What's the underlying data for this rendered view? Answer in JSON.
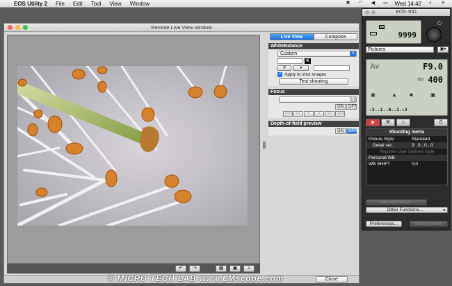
{
  "menubar": {
    "app": "EOS Utility 2",
    "items": [
      "File",
      "Edit",
      "Tool",
      "View",
      "Window"
    ],
    "time": "Wed 14:42"
  },
  "liveview": {
    "title": "Remote Live View window",
    "tabs": [
      "Live View",
      "Compose"
    ],
    "wb_header": "WhiteBalance",
    "wb_value": "Custom",
    "k_label": "K",
    "apply_label": "Apply to shot images",
    "test_shooting": "Test shooting",
    "focus_header": "Focus",
    "focus_on": "ON",
    "focus_off": "OFF",
    "focus_nav": [
      "<<<",
      "<<",
      "<",
      ">",
      ">>",
      ">>>"
    ],
    "dof_header": "Depth-of-field preview",
    "dof_on": "ON",
    "dof_off": "OFF",
    "close_label": "Close"
  },
  "eos": {
    "title": "EOS 40D",
    "shots": "9999",
    "picture_style": "Pictures",
    "mode": "Av",
    "aperture": "F9.0",
    "iso_label": "ISO",
    "iso": "400",
    "exposure_scale": "-2..1..0..1.:2",
    "menu_title": "Shooting menu",
    "menu_rows": [
      {
        "key": "Picture Style",
        "value": "Standard"
      },
      {
        "key": "Detail set.",
        "value": "3 , 0 , 0 , 0"
      },
      {
        "key": "Register User Defined style",
        "value": ""
      },
      {
        "key": "Personal WB",
        "value": ""
      },
      {
        "key": "WB SHIFT",
        "value": "0,0"
      }
    ],
    "live_view_shoot": "Live view shoot...",
    "other_functions": "Other Functions...",
    "preferences": "Preferences...",
    "main_window": "Main Window"
  },
  "watermark": "© MICRO TECH LAB  www.LMscope.com"
}
